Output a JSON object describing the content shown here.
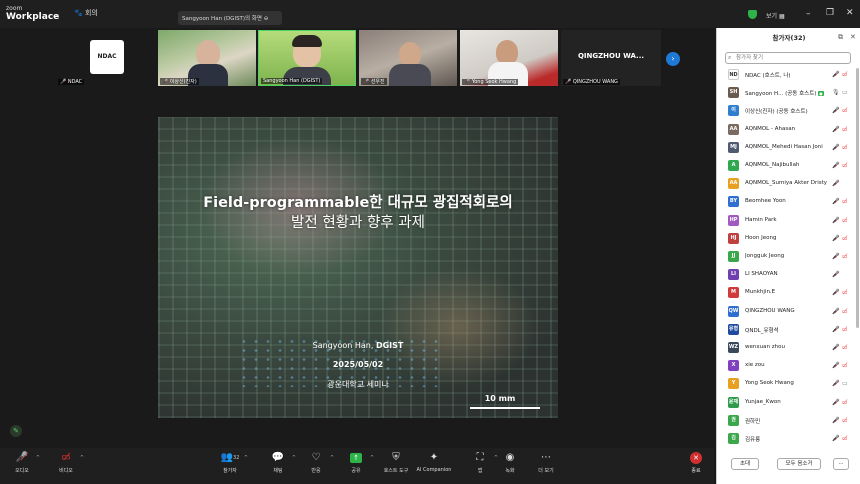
{
  "titlebar": {
    "brand_small": "zoom",
    "brand_big": "Workplace",
    "meeting_label": "회의",
    "share_pill": "Sangyoon Han (DGIST)의 화면",
    "view_label": "보기",
    "min_glyph": "–",
    "max_glyph": "❐",
    "close_glyph": "✕"
  },
  "thumbnails": [
    {
      "label": "NDAC",
      "logo_text": "NDAC"
    },
    {
      "label": "이상신(진자)"
    },
    {
      "label": "Sangyoon Han (DGIST)"
    },
    {
      "label": "선우진"
    },
    {
      "label": "Yong Seok Hwang"
    },
    {
      "label": "QINGZHOU WANG",
      "big": "QINGZHOU WA..."
    }
  ],
  "slide": {
    "title_line1": "Field-programmable한 대규모 광집적회로의",
    "title_line2": "발전 현황과 향후 과제",
    "author_prefix": "Sangyoon Han, ",
    "author_org": "DGIST",
    "date": "2025/05/02",
    "venue": "광운대학교 세미나",
    "scale": "10 mm"
  },
  "toolbar": {
    "audio": "오디오",
    "video": "비디오",
    "participants": "참가자",
    "participants_count": "32",
    "react": "반응",
    "chat": "채팅",
    "share": "공유",
    "host_tools": "호스트 도구",
    "ai": "AI Companion",
    "apps": "앱",
    "record": "녹화",
    "more": "더 보기",
    "end": "종료"
  },
  "panel": {
    "title": "참가자(32)",
    "search_placeholder": "참가자 찾기",
    "participants": [
      {
        "name": "NDAC (호스트, 나)",
        "initials": "ND",
        "color": "#ffffff",
        "video": "off"
      },
      {
        "name": "Sangyoon H... (공동 호스트)",
        "initials": "SH",
        "color": "#6b5a4e",
        "badge": "●",
        "mic": "on",
        "video": "on"
      },
      {
        "name": "이상신(진자) (공동 호스트)",
        "initials": "이",
        "color": "#2f7fd0",
        "video": "off"
      },
      {
        "name": "AQNMOL - Ahasan",
        "initials": "AA",
        "color": "#7a6a60",
        "video": "off"
      },
      {
        "name": "AQNMOL_Mehedi Hasan Joni",
        "initials": "MJ",
        "color": "#505a70",
        "video": "off"
      },
      {
        "name": "AQNMOL_Najibullah",
        "initials": "A",
        "color": "#2fa84f",
        "video": "off"
      },
      {
        "name": "AQNMOL_Sumiya Akter Dristy",
        "initials": "AA",
        "color": "#e8a020",
        "video": "none"
      },
      {
        "name": "Beomhee Yoon",
        "initials": "BY",
        "color": "#2f6fd0",
        "video": "off"
      },
      {
        "name": "Hamin Park",
        "initials": "HP",
        "color": "#a05ac0",
        "video": "off"
      },
      {
        "name": "Hoon Jeong",
        "initials": "HJ",
        "color": "#c04040",
        "video": "off"
      },
      {
        "name": "Jongguk Jeong",
        "initials": "JJ",
        "color": "#3aa84a",
        "video": "off"
      },
      {
        "name": "LI SHAOYAN",
        "initials": "LI",
        "color": "#7040b0",
        "video": "none"
      },
      {
        "name": "Munkhjin.E",
        "initials": "M",
        "color": "#d03a3a",
        "video": "off"
      },
      {
        "name": "QINGZHOU WANG",
        "initials": "QW",
        "color": "#2f6fd0",
        "video": "off"
      },
      {
        "name": "QNDL_유형석",
        "initials": "유형",
        "color": "#204aa0",
        "video": "off"
      },
      {
        "name": "wenxuan zhou",
        "initials": "WZ",
        "color": "#3a4a5a",
        "video": "off"
      },
      {
        "name": "xie zou",
        "initials": "X",
        "color": "#8040c0",
        "video": "off"
      },
      {
        "name": "Yong Seok Hwang",
        "initials": "Y",
        "color": "#e8a020",
        "video": "camoff"
      },
      {
        "name": "Yunjae_Kwon",
        "initials": "윤재",
        "color": "#2f9a4a",
        "video": "off"
      },
      {
        "name": "권하민",
        "initials": "권",
        "color": "#3aa84a",
        "video": "off"
      },
      {
        "name": "김유릉",
        "initials": "김",
        "color": "#3aa84a",
        "video": "off"
      }
    ],
    "invite": "초대",
    "mute_all": "모두 음소거",
    "more": "···"
  }
}
